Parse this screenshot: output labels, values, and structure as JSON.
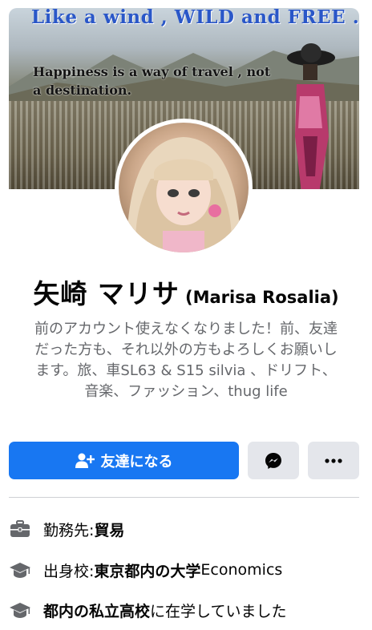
{
  "cover": {
    "line1": "Like a wind , WILD and FREE ...",
    "line2": "Happiness is a way of travel , not a destination."
  },
  "profile": {
    "name": "矢崎 マリサ",
    "alt_name": "(Marisa Rosalia)",
    "bio": "前のアカウント使えなくなりました！前、友達だった方も、それ以外の方もよろしくお願いします。旅、車SL63 & S15 silvia 、ドリフト、音楽、ファッション、thug life"
  },
  "actions": {
    "add_friend_label": "友達になる",
    "messenger_icon": "messenger-icon",
    "more_icon": "more-icon"
  },
  "info": {
    "work": {
      "label": "勤務先: ",
      "value": "貿易",
      "icon": "briefcase-icon"
    },
    "education1": {
      "label": "出身校: ",
      "value": "東京都内の大学",
      "suffix": " Economics",
      "icon": "graduation-cap-icon"
    },
    "education2": {
      "value": "都内の私立高校",
      "suffix": "に在学していました",
      "icon": "graduation-cap-icon"
    }
  },
  "colors": {
    "primary": "#1877f2",
    "secondary_button": "#e4e6eb",
    "secondary_text": "#65676b",
    "icon_grey": "#65676b"
  }
}
